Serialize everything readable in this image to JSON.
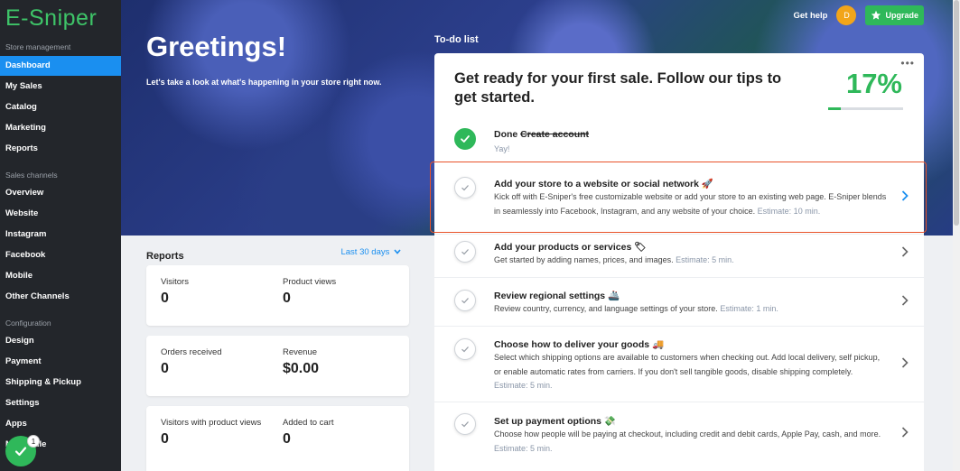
{
  "brand": {
    "logo": "E-Sniper",
    "accent": "#3ec468",
    "active_blue": "#1a8ff0"
  },
  "sidebar": {
    "sections": [
      {
        "label": "Store management",
        "items": [
          "Dashboard",
          "My Sales",
          "Catalog",
          "Marketing",
          "Reports"
        ]
      },
      {
        "label": "Sales channels",
        "items": [
          "Overview",
          "Website",
          "Instagram",
          "Facebook",
          "Mobile",
          "Other Channels"
        ]
      },
      {
        "label": "Configuration",
        "items": [
          "Design",
          "Payment",
          "Shipping & Pickup",
          "Settings",
          "Apps",
          "My Profile"
        ]
      }
    ],
    "active": "Dashboard",
    "fab_badge": "1"
  },
  "header": {
    "help": "Get help",
    "avatar": "D",
    "upgrade": "Upgrade"
  },
  "hero": {
    "title": "Greetings!",
    "subtitle": "Let's take a look at what's happening in your store right now.",
    "todo_label": "To-do list"
  },
  "reports": {
    "title": "Reports",
    "range": "Last 30 days",
    "cards": [
      [
        {
          "label": "Visitors",
          "value": "0"
        },
        {
          "label": "Product views",
          "value": "0"
        }
      ],
      [
        {
          "label": "Orders received",
          "value": "0"
        },
        {
          "label": "Revenue",
          "value": "$0.00"
        }
      ],
      [
        {
          "label": "Visitors with product views",
          "value": "0"
        },
        {
          "label": "Added to cart",
          "value": "0"
        }
      ]
    ]
  },
  "todo": {
    "heading": "Get ready for your first sale. Follow our tips to get started.",
    "percent": "17%",
    "progress": 0.17,
    "done_task": {
      "prefix": "Done",
      "title": "Create account",
      "desc": "Yay!"
    },
    "tasks": [
      {
        "title": "Add your store to a website or social network 🚀",
        "desc": "Kick off with E-Sniper's free customizable website or add your store to an existing web page. E-Sniper blends in seamlessly into Facebook, Instagram, and any website of your choice.",
        "estimate": "Estimate: 10 min."
      },
      {
        "title": "Add your products or services 🏷",
        "desc": "Get started by adding names, prices, and images.",
        "estimate": "Estimate: 5 min."
      },
      {
        "title": "Review regional settings 🚢",
        "desc": "Review country, currency, and language settings of your store.",
        "estimate": "Estimate: 1 min."
      },
      {
        "title": "Choose how to deliver your goods 🚚",
        "desc": "Select which shipping options are available to customers when checking out. Add local delivery, self pickup, or enable automatic rates from carriers. If you don't sell tangible goods, disable shipping completely.",
        "estimate": "Estimate: 5 min."
      },
      {
        "title": "Set up payment options 💸",
        "desc": "Choose how people will be paying at checkout, including credit and debit cards, Apple Pay, cash, and more.",
        "estimate": "Estimate: 5 min."
      }
    ]
  }
}
